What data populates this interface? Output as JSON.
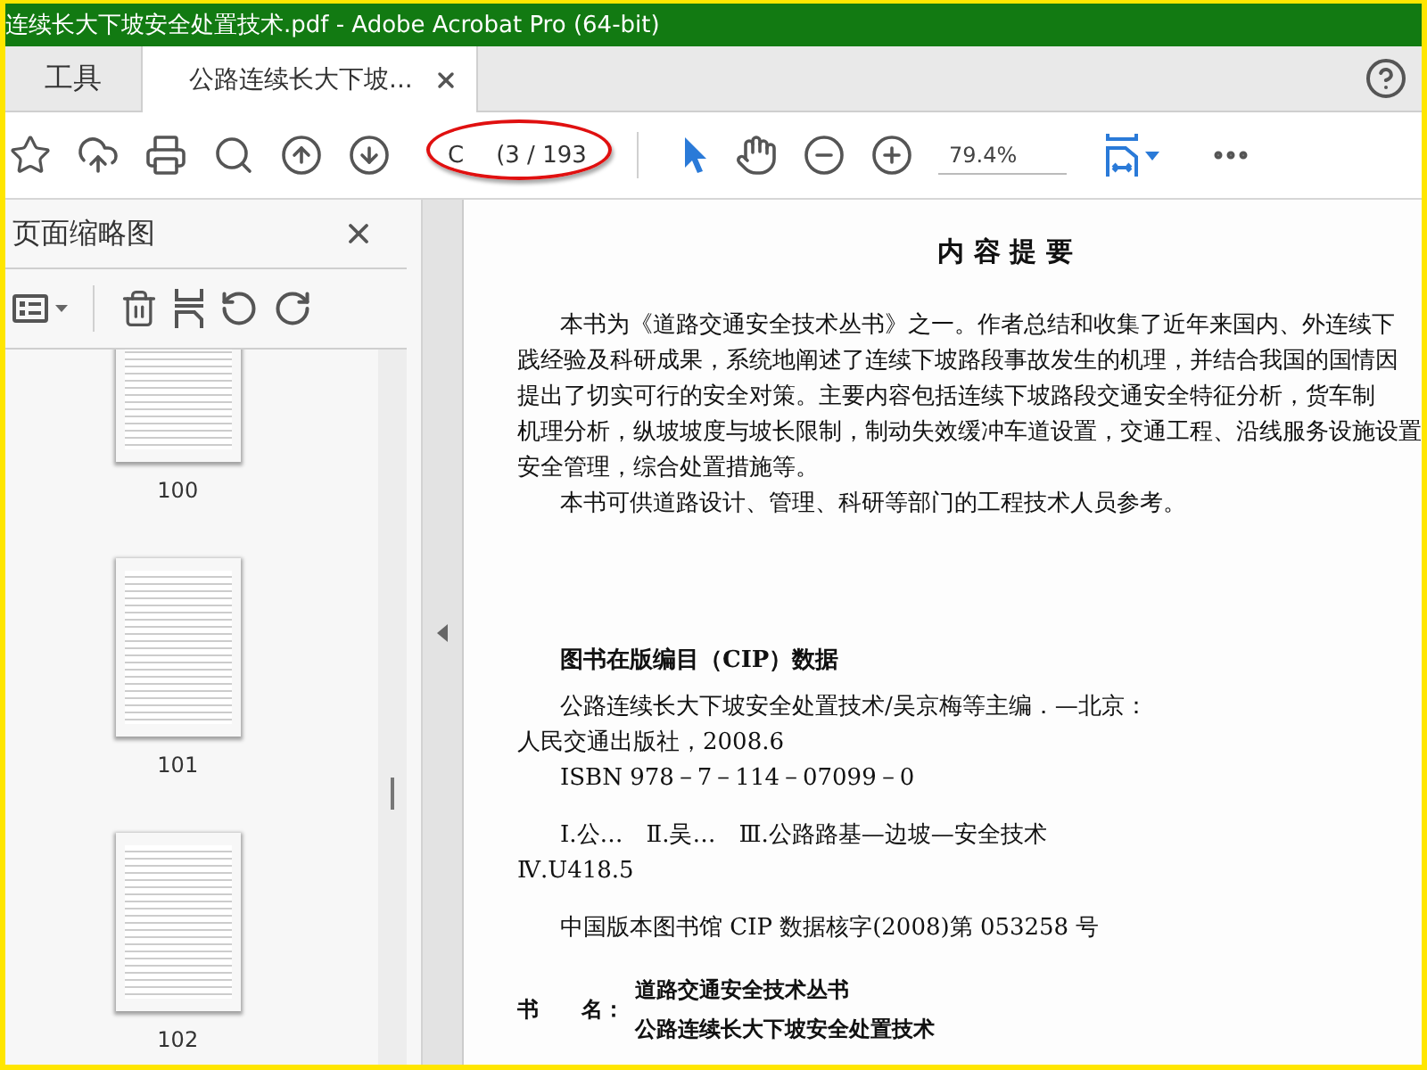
{
  "window": {
    "title": "连续长大下坡安全处置技术.pdf - Adobe Acrobat Pro (64-bit)"
  },
  "tabs": [
    {
      "label": "工具",
      "selected": false
    },
    {
      "label": "公路连续长大下坡...",
      "selected": true
    }
  ],
  "toolbar": {
    "page_field": {
      "value": "C",
      "page_count": "(3 / 193"
    },
    "zoom": "79.4%"
  },
  "sidebar": {
    "title": "页面缩略图",
    "thumbnails": [
      {
        "label": "100"
      },
      {
        "label": "101"
      },
      {
        "label": "102"
      }
    ]
  },
  "document": {
    "heading": "内 容 提 要",
    "summary_paragraphs": [
      [
        "本书为《道路交通安全技术丛书》之一。作者总结和收集了近年来国内、外连续下",
        "践经验及科研成果，系统地阐述了连续下坡路段事故发生的机理，并结合我国的国情因",
        "提出了切实可行的安全对策。主要内容包括连续下坡路段交通安全特征分析，货车制",
        "机理分析，纵坡坡度与坡长限制，制动失效缓冲车道设置，交通工程、沿线服务设施设置",
        "安全管理，综合处置措施等。"
      ],
      [
        "本书可供道路设计、管理、科研等部门的工程技术人员参考。"
      ]
    ],
    "cip_title": "图书在版编目（CIP）数据",
    "cip_groups": [
      [
        [
          "公路连续长大下坡安全处置技术/吴京梅等主编．—北京：",
          "人民交通出版社，2008.6"
        ],
        [
          "ISBN 978－7－114－07099－0"
        ]
      ],
      [
        [
          "Ⅰ.公…　Ⅱ.吴…　Ⅲ.公路路基—边坡—安全技术",
          "Ⅳ.U418.5"
        ]
      ],
      [
        [
          "中国版本图书馆 CIP 数据核字(2008)第 053258 号"
        ]
      ]
    ],
    "book_name_label": "书　　名：",
    "book_names": [
      "道路交通安全技术丛书",
      "公路连续长大下坡安全处置技术"
    ]
  }
}
